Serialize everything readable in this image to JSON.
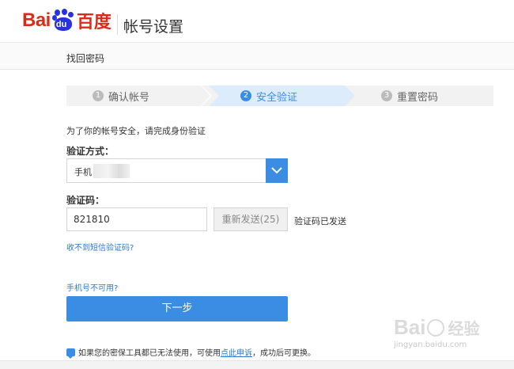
{
  "header": {
    "logo_text_latin": "Bai",
    "logo_text_du": "du",
    "logo_text_cn": "百度",
    "title": "帐号设置"
  },
  "subbar": {
    "breadcrumb": "找回密码"
  },
  "steps": [
    {
      "num": "1",
      "label": "确认帐号",
      "active": false
    },
    {
      "num": "2",
      "label": "安全验证",
      "active": true
    },
    {
      "num": "3",
      "label": "重置密码",
      "active": false
    }
  ],
  "form": {
    "hint": "为了你的帐号安全，请完成身份验证",
    "method_label": "验证方式：",
    "method_value": "手机",
    "code_label": "验证码：",
    "code_value": "821810",
    "resend_label": "重新发送(25)",
    "sent_status": "验证码已发送",
    "no_sms_link": "收不到短信验证码?",
    "phone_unavailable_link": "手机号不可用?",
    "next_button": "下一步"
  },
  "footer": {
    "text_before": "如果您的密保工具都已无法使用，可使用",
    "appeal_link": "点此申诉",
    "text_after": "，成功后可更换。"
  },
  "watermark": {
    "brand": "Bai",
    "brand_cn": "经验",
    "url": "jingyan.baidu.com"
  },
  "colors": {
    "accent": "#3a8de3",
    "brand_red": "#de2a18",
    "brand_blue": "#2932e1",
    "link": "#2b7bd0"
  }
}
